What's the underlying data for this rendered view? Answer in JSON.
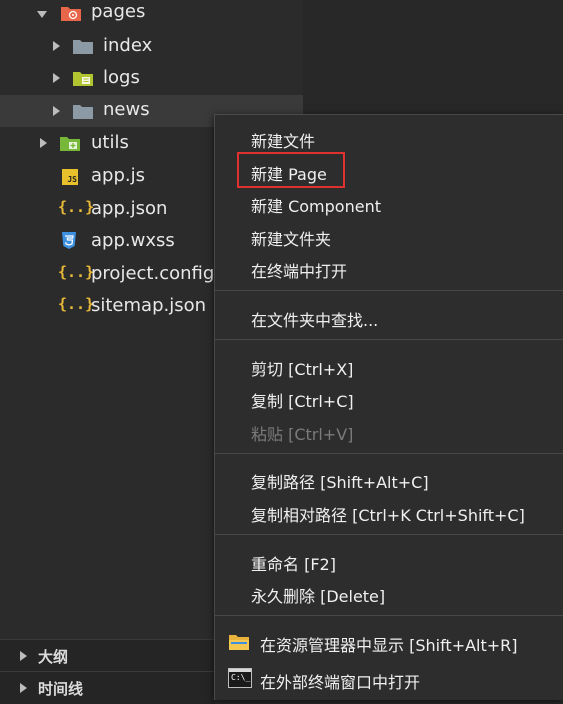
{
  "explorer": {
    "items": [
      {
        "label": "pages",
        "icon": "folder-pages-icon",
        "expanded": true
      },
      {
        "label": "index",
        "icon": "folder-icon"
      },
      {
        "label": "logs",
        "icon": "folder-logs-icon"
      },
      {
        "label": "news",
        "icon": "folder-icon",
        "selected": true
      },
      {
        "label": "utils",
        "icon": "folder-utils-icon"
      },
      {
        "label": "app.js",
        "icon": "js-file-icon"
      },
      {
        "label": "app.json",
        "icon": "json-file-icon"
      },
      {
        "label": "app.wxss",
        "icon": "css-file-icon"
      },
      {
        "label": "project.config",
        "icon": "json-file-icon"
      },
      {
        "label": "sitemap.json",
        "icon": "json-file-icon"
      }
    ],
    "js_badge": "JS",
    "json_badge": "{..}"
  },
  "bottom_panels": [
    {
      "label": "大纲"
    },
    {
      "label": "时间线"
    }
  ],
  "context_menu": {
    "items": [
      {
        "label": "新建文件"
      },
      {
        "label": "新建 Page",
        "highlighted": true
      },
      {
        "label": "新建 Component"
      },
      {
        "label": "新建文件夹"
      },
      {
        "label": "在终端中打开"
      },
      {
        "label": "在文件夹中查找..."
      },
      {
        "label": "剪切  [Ctrl+X]"
      },
      {
        "label": "复制  [Ctrl+C]"
      },
      {
        "label": "粘贴  [Ctrl+V]",
        "disabled": true
      },
      {
        "label": "复制路径  [Shift+Alt+C]"
      },
      {
        "label": "复制相对路径  [Ctrl+K Ctrl+Shift+C]"
      },
      {
        "label": "重命名  [F2]"
      },
      {
        "label": "永久删除  [Delete]"
      },
      {
        "label": "在资源管理器中显示  [Shift+Alt+R]",
        "icon": "explorer-folder-icon"
      },
      {
        "label": "在外部终端窗口中打开",
        "icon": "terminal-icon"
      }
    ],
    "terminal_badge": "C:\\_"
  },
  "colors": {
    "background": "#2b2b2b",
    "menu_background": "#2d2d2d",
    "highlight_border": "#e03131",
    "folder_pages": "#e8674a",
    "folder_gray": "#8c9aa6",
    "folder_logs": "#b2c430",
    "folder_utils": "#77b83b",
    "json_icon": "#e8b837",
    "css_icon": "#3d8fe0"
  }
}
